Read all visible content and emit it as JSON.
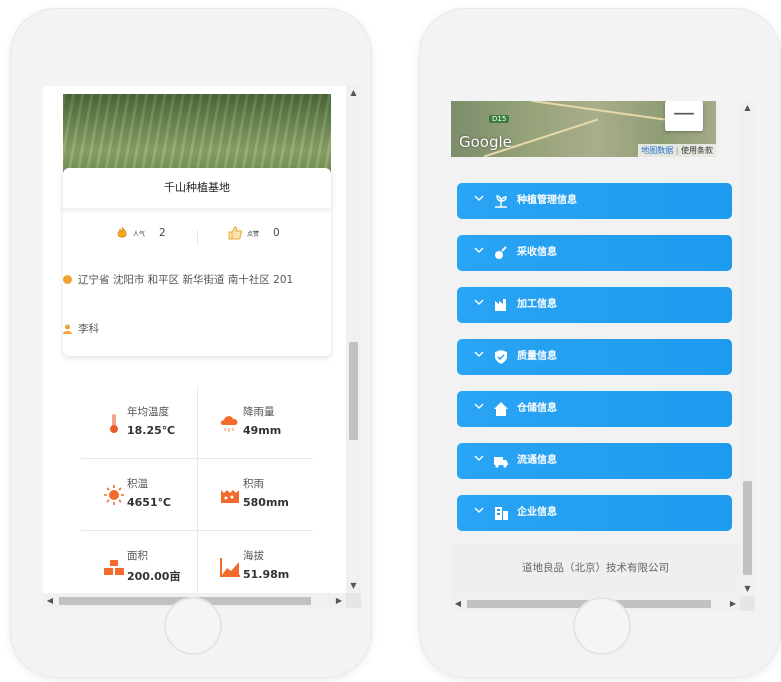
{
  "left_page": {
    "base_name": "千山种植基地",
    "stats": {
      "popularity_label": "人气",
      "popularity_value": "2",
      "likes_label": "点赞",
      "likes_value": "0"
    },
    "address": "辽宁省 沈阳市 和平区 新华街道 南十社区 201",
    "contact_person": "李科",
    "metrics": [
      {
        "label": "年均温度",
        "value": "18.25℃",
        "icon": "thermometer-icon"
      },
      {
        "label": "降雨量",
        "value": "49mm",
        "icon": "rain-cloud-icon"
      },
      {
        "label": "积温",
        "value": "4651℃",
        "icon": "sun-icon"
      },
      {
        "label": "积雨",
        "value": "580mm",
        "icon": "water-tank-icon"
      },
      {
        "label": "面积",
        "value": "200.00亩",
        "icon": "area-blocks-icon"
      },
      {
        "label": "海拔",
        "value": "51.98m",
        "icon": "altitude-chart-icon"
      }
    ],
    "colors": {
      "accent_orange": "#f57c3a",
      "scrollbar": "#c1c1c1"
    }
  },
  "right_page": {
    "map": {
      "brand": "Google",
      "shield": "D15",
      "map_data": "地图数据",
      "terms": "使用条款",
      "zoom_out": "—"
    },
    "sections": [
      {
        "label": "种植管理信息",
        "icon": "plant-icon"
      },
      {
        "label": "采收信息",
        "icon": "harvest-icon"
      },
      {
        "label": "加工信息",
        "icon": "factory-icon"
      },
      {
        "label": "质量信息",
        "icon": "shield-check-icon"
      },
      {
        "label": "仓储信息",
        "icon": "warehouse-icon"
      },
      {
        "label": "流通信息",
        "icon": "truck-icon"
      },
      {
        "label": "企业信息",
        "icon": "building-icon"
      }
    ],
    "footer": "道地良品（北京）技术有限公司",
    "colors": {
      "accordion": "#1e9bef"
    }
  },
  "scrollbar": {
    "up": "▲",
    "down": "▼",
    "left": "◀",
    "right": "▶"
  }
}
